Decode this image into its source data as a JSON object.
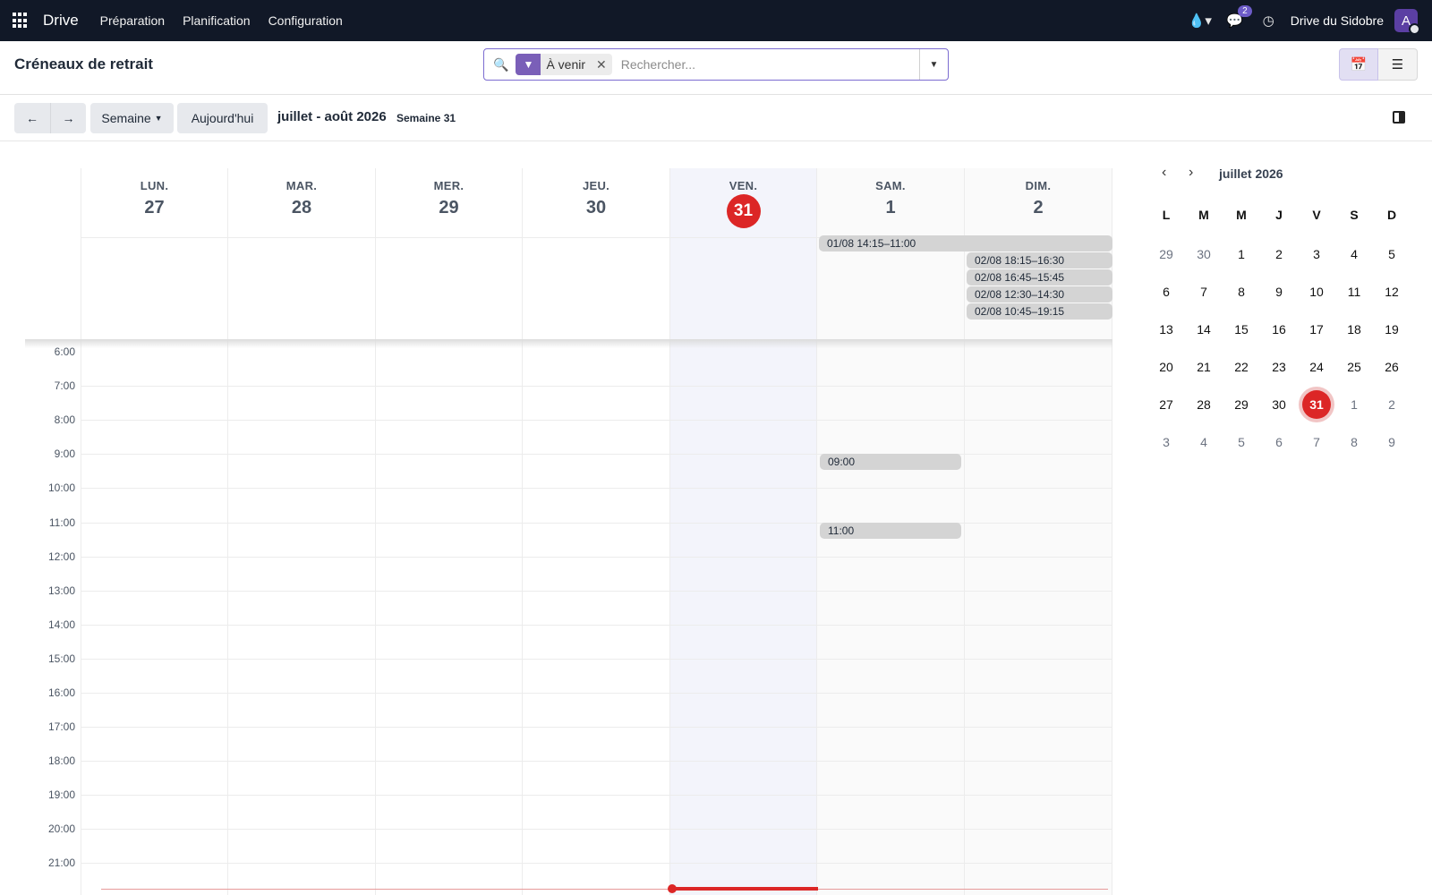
{
  "navbar": {
    "brand": "Drive",
    "menu": [
      "Préparation",
      "Planification",
      "Configuration"
    ],
    "messages_badge": "2",
    "company": "Drive du Sidobre",
    "avatar_letter": "A"
  },
  "control": {
    "title": "Créneaux de retrait",
    "facet_label": "À venir",
    "search_placeholder": "Rechercher..."
  },
  "toolbar": {
    "scale_label": "Semaine",
    "today_label": "Aujourd'hui",
    "range_title": "juillet - août 2026",
    "week_label": "Semaine 31"
  },
  "week": {
    "days": [
      {
        "name": "LUN.",
        "num": "27"
      },
      {
        "name": "MAR.",
        "num": "28"
      },
      {
        "name": "MER.",
        "num": "29"
      },
      {
        "name": "JEU.",
        "num": "30"
      },
      {
        "name": "VEN.",
        "num": "31"
      },
      {
        "name": "SAM.",
        "num": "1"
      },
      {
        "name": "DIM.",
        "num": "2"
      }
    ],
    "hours": [
      "6:00",
      "7:00",
      "8:00",
      "9:00",
      "10:00",
      "11:00",
      "12:00",
      "13:00",
      "14:00",
      "15:00",
      "16:00",
      "17:00",
      "18:00",
      "19:00",
      "20:00",
      "21:00"
    ],
    "allday_events": [
      "01/08 14:15–11:00",
      "02/08 18:15–16:30",
      "02/08 16:45–15:45",
      "02/08 12:30–14:30",
      "02/08 10:45–19:15"
    ],
    "timed_events": [
      "09:00",
      "11:00"
    ]
  },
  "mini_calendar": {
    "title": "juillet 2026",
    "dow": [
      "L",
      "M",
      "M",
      "J",
      "V",
      "S",
      "D"
    ],
    "weeks": [
      [
        "29",
        "30",
        "1",
        "2",
        "3",
        "4",
        "5"
      ],
      [
        "6",
        "7",
        "8",
        "9",
        "10",
        "11",
        "12"
      ],
      [
        "13",
        "14",
        "15",
        "16",
        "17",
        "18",
        "19"
      ],
      [
        "20",
        "21",
        "22",
        "23",
        "24",
        "25",
        "26"
      ],
      [
        "27",
        "28",
        "29",
        "30",
        "31",
        "1",
        "2"
      ],
      [
        "3",
        "4",
        "5",
        "6",
        "7",
        "8",
        "9"
      ]
    ]
  },
  "colors": {
    "accent": "#7a5fb8",
    "today": "#dc2626",
    "navbar": "#111827",
    "event": "#d4d4d4"
  }
}
